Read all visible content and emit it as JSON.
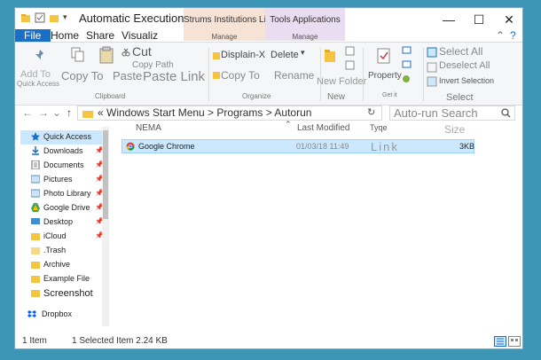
{
  "window": {
    "title": "Automatic Execution"
  },
  "context_tabs": [
    {
      "label": "Strums Institutions Links",
      "manage": "Manage"
    },
    {
      "label": "Tools Applications",
      "manage": "Manage"
    }
  ],
  "window_controls": {
    "minimize": "—",
    "maximize": "☐",
    "close": "✕"
  },
  "tabs": {
    "file": "File",
    "home": "Home",
    "share": "Share",
    "view": "Visualiz",
    "collapse": "⌃",
    "help": "?"
  },
  "ribbon": {
    "clipboard": {
      "quick_access": "Quick Access",
      "add_to": "Add To",
      "copy_to": "Copy To",
      "paste": "Paste",
      "paste_link": "Paste Link",
      "cut": "Cut",
      "copy_path": "Copy Path",
      "group": "Clipboard"
    },
    "organize": {
      "displace": "Displain-X",
      "delete": "Delete",
      "copy_to": "Copy To",
      "rename": "Rename",
      "group": "Organize"
    },
    "new": {
      "new_folder": "New Folder",
      "group": "New"
    },
    "open": {
      "property": "Property",
      "group": "Get it"
    },
    "select": {
      "select_all": "Select All",
      "deselect_all": "Deselect All",
      "invert": "Invert Selection",
      "group": "Select"
    }
  },
  "address": {
    "back": "←",
    "forward": "→",
    "dropdown": "⌄",
    "up": "↑",
    "path": "« Windows Start Menu > Programs > Autorun",
    "refresh": "↻",
    "search_placeholder": "Auto-run Search"
  },
  "nav": {
    "items": [
      {
        "label": "Quick Access",
        "pin": ""
      },
      {
        "label": "Downloads",
        "pin": "📌"
      },
      {
        "label": "Documents",
        "pin": "📌"
      },
      {
        "label": "Pictures",
        "pin": "📌"
      },
      {
        "label": "Photo Library",
        "pin": "📌"
      },
      {
        "label": "Google Drive",
        "pin": "📌"
      },
      {
        "label": "Desktop",
        "pin": "📌"
      },
      {
        "label": "iCloud",
        "pin": "📌"
      },
      {
        "label": ".Trash",
        "pin": ""
      },
      {
        "label": "Archive",
        "pin": ""
      },
      {
        "label": "Example File",
        "pin": ""
      },
      {
        "label": "Screenshot",
        "pin": ""
      },
      {
        "label": "Dropbox",
        "pin": ""
      }
    ]
  },
  "columns": {
    "name": "NEMA",
    "modified": "Last Modified",
    "type": "Tyqe",
    "size": "Size"
  },
  "files": [
    {
      "name": "Google Chrome",
      "modified": "01/03/18 11:49",
      "type": "Link",
      "size": "3KB"
    }
  ],
  "status": {
    "count": "1 Item",
    "selected": "1 Selected Item 2.24 KB"
  },
  "colors": {
    "accent": "#1a6fc4",
    "selection": "#cce8ff"
  }
}
